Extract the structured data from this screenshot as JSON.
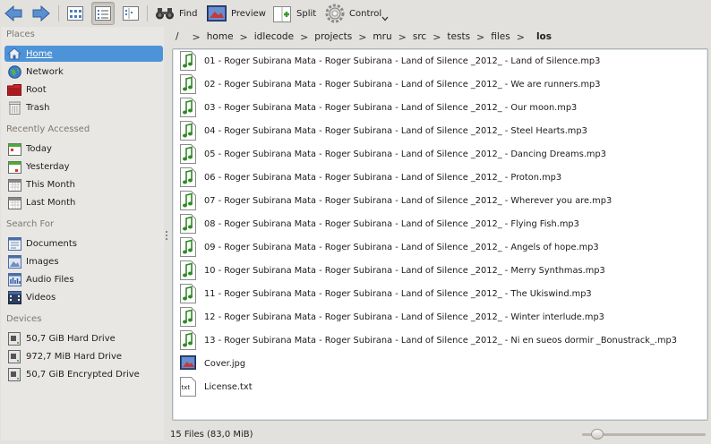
{
  "toolbar": {
    "find_label": "Find",
    "preview_label": "Preview",
    "split_label": "Split",
    "control_label": "Control"
  },
  "sidebar": {
    "places_header": "Places",
    "places": [
      {
        "label": "Home",
        "icon": "home-icon"
      },
      {
        "label": "Network",
        "icon": "network-icon"
      },
      {
        "label": "Root",
        "icon": "root-folder-icon"
      },
      {
        "label": "Trash",
        "icon": "trash-icon"
      }
    ],
    "recent_header": "Recently Accessed",
    "recent": [
      {
        "label": "Today",
        "icon": "calendar-today-icon"
      },
      {
        "label": "Yesterday",
        "icon": "calendar-yesterday-icon"
      },
      {
        "label": "This Month",
        "icon": "calendar-month-icon"
      },
      {
        "label": "Last Month",
        "icon": "calendar-last-month-icon"
      }
    ],
    "search_header": "Search For",
    "search": [
      {
        "label": "Documents",
        "icon": "documents-icon"
      },
      {
        "label": "Images",
        "icon": "images-icon"
      },
      {
        "label": "Audio Files",
        "icon": "audio-files-icon"
      },
      {
        "label": "Videos",
        "icon": "videos-icon"
      }
    ],
    "devices_header": "Devices",
    "devices": [
      {
        "label": "50,7 GiB Hard Drive",
        "icon": "hard-drive-icon"
      },
      {
        "label": "972,7 MiB Hard Drive",
        "icon": "hard-drive-icon"
      },
      {
        "label": "50,7 GiB Encrypted Drive",
        "icon": "encrypted-drive-icon"
      }
    ]
  },
  "breadcrumb": {
    "root": "/",
    "segments": [
      "home",
      "idlecode",
      "projects",
      "mru",
      "src",
      "tests",
      "files"
    ],
    "current": "los"
  },
  "files": [
    {
      "name": "01 - Roger Subirana Mata - Roger Subirana - Land of Silence _2012_ - Land of Silence.mp3",
      "type": "audio"
    },
    {
      "name": "02 - Roger Subirana Mata - Roger Subirana - Land of Silence _2012_ - We are runners.mp3",
      "type": "audio"
    },
    {
      "name": "03 - Roger Subirana Mata - Roger Subirana - Land of Silence _2012_ - Our moon.mp3",
      "type": "audio"
    },
    {
      "name": "04 - Roger Subirana Mata - Roger Subirana - Land of Silence _2012_ - Steel Hearts.mp3",
      "type": "audio"
    },
    {
      "name": "05 - Roger Subirana Mata - Roger Subirana - Land of Silence _2012_ - Dancing Dreams.mp3",
      "type": "audio"
    },
    {
      "name": "06 - Roger Subirana Mata - Roger Subirana - Land of Silence _2012_ - Proton.mp3",
      "type": "audio"
    },
    {
      "name": "07 - Roger Subirana Mata - Roger Subirana - Land of Silence _2012_ - Wherever you are.mp3",
      "type": "audio"
    },
    {
      "name": "08 - Roger Subirana Mata - Roger Subirana - Land of Silence _2012_ - Flying Fish.mp3",
      "type": "audio"
    },
    {
      "name": "09 - Roger Subirana Mata - Roger Subirana - Land of Silence _2012_ - Angels of hope.mp3",
      "type": "audio"
    },
    {
      "name": "10 - Roger Subirana Mata - Roger Subirana - Land of Silence _2012_ - Merry Synthmas.mp3",
      "type": "audio"
    },
    {
      "name": "11 - Roger Subirana Mata - Roger Subirana - Land of Silence _2012_ - The Ukiswind.mp3",
      "type": "audio"
    },
    {
      "name": "12 - Roger Subirana Mata - Roger Subirana - Land of Silence _2012_ - Winter interlude.mp3",
      "type": "audio"
    },
    {
      "name": "13 - Roger Subirana Mata - Roger Subirana - Land of Silence _2012_ - Ni en sueos dormir _Bonustrack_.mp3",
      "type": "audio"
    },
    {
      "name": "Cover.jpg",
      "type": "image"
    },
    {
      "name": "License.txt",
      "type": "text"
    }
  ],
  "status": {
    "text": "15 Files (83,0 MiB)",
    "zoom_level": 0.05
  },
  "colors": {
    "accent": "#4d93d7",
    "background": "#e3e1dd"
  }
}
